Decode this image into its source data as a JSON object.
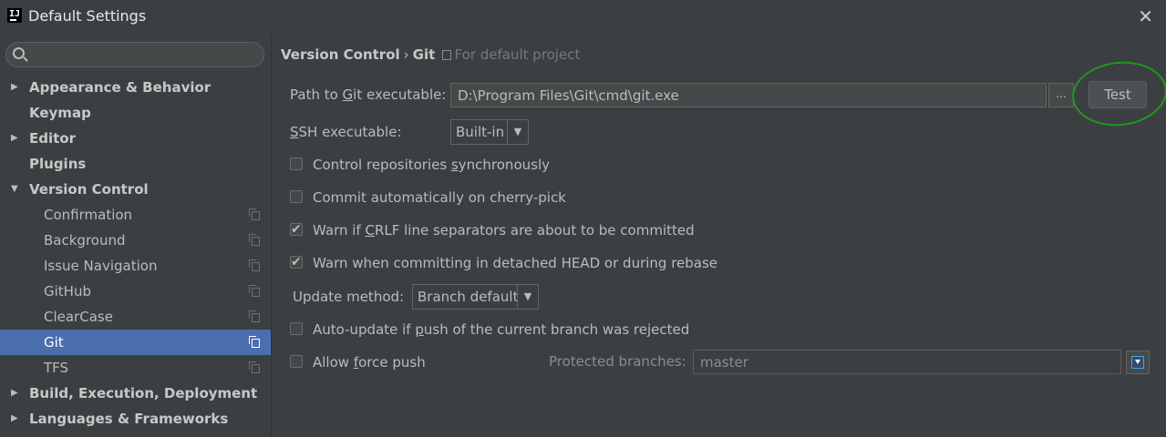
{
  "window": {
    "title": "Default Settings",
    "app_icon": "intellij-idea-icon",
    "close_label": "✕"
  },
  "sidebar": {
    "search": {
      "placeholder": "",
      "value": ""
    },
    "items": [
      {
        "label": "Appearance & Behavior",
        "level": "top",
        "arrow": "▶"
      },
      {
        "label": "Keymap",
        "level": "top",
        "arrow": ""
      },
      {
        "label": "Editor",
        "level": "top",
        "arrow": "▶"
      },
      {
        "label": "Plugins",
        "level": "top",
        "arrow": ""
      },
      {
        "label": "Version Control",
        "level": "top",
        "arrow": "▼"
      },
      {
        "label": "Confirmation",
        "level": "child"
      },
      {
        "label": "Background",
        "level": "child"
      },
      {
        "label": "Issue Navigation",
        "level": "child"
      },
      {
        "label": "GitHub",
        "level": "child"
      },
      {
        "label": "ClearCase",
        "level": "child"
      },
      {
        "label": "Git",
        "level": "child",
        "selected": true
      },
      {
        "label": "TFS",
        "level": "child"
      },
      {
        "label": "Build, Execution, Deployment",
        "level": "top",
        "arrow": "▶"
      },
      {
        "label": "Languages & Frameworks",
        "level": "top",
        "arrow": "▶"
      }
    ]
  },
  "breadcrumb": {
    "parent": "Version Control",
    "separator": "›",
    "current": "Git",
    "scope": "For default project"
  },
  "git": {
    "path_label_pre": "Path to ",
    "path_label_mnemonic": "G",
    "path_label_post": "it executable:",
    "path_value": "D:\\Program Files\\Git\\cmd\\git.exe",
    "browse_label": "...",
    "test_label": "Test",
    "ssh_label_mnemonic": "S",
    "ssh_label_post": "SH executable:",
    "ssh_value": "Built-in",
    "cb1_pre": "Control repositories ",
    "cb1_mn": "s",
    "cb1_post": "ynchronously",
    "cb1_checked": false,
    "cb2": "Commit automatically on cherry-pick",
    "cb2_checked": false,
    "cb3_pre": "Warn if ",
    "cb3_mn": "C",
    "cb3_post": "RLF line separators are about to be committed",
    "cb3_checked": true,
    "cb4": "Warn when committing in detached HEAD or during rebase",
    "cb4_checked": true,
    "update_label": "Update method:",
    "update_value": "Branch default",
    "cb5_pre": "Auto-update if ",
    "cb5_mn": "p",
    "cb5_post": "ush of the current branch was rejected",
    "cb5_checked": false,
    "cb6_pre": "Allow ",
    "cb6_mn": "f",
    "cb6_post": "orce push",
    "cb6_checked": false,
    "protected_label": "Protected branches:",
    "protected_value": "master"
  },
  "colors": {
    "selection": "#4b6eaf",
    "background": "#3c3f41",
    "annotation": "#1c9a1c"
  }
}
